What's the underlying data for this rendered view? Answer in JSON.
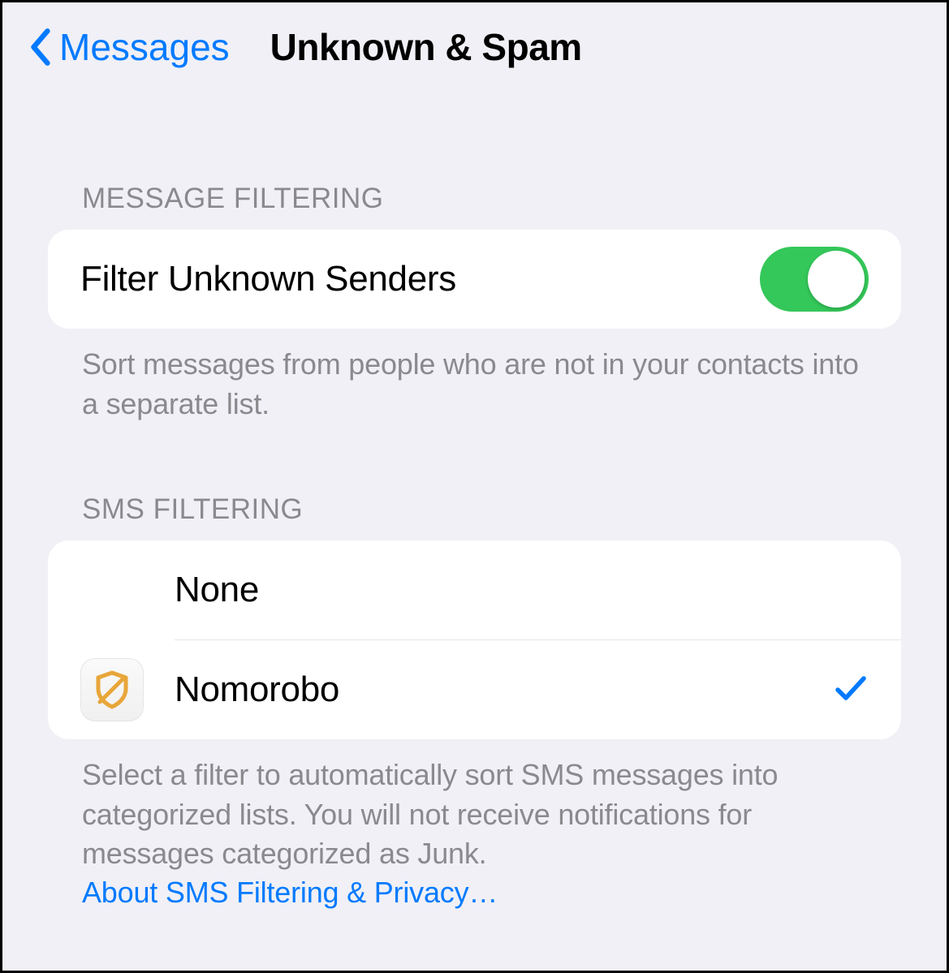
{
  "nav": {
    "back_label": "Messages",
    "title": "Unknown & Spam"
  },
  "sections": {
    "message_filtering": {
      "header": "MESSAGE FILTERING",
      "toggle_label": "Filter Unknown Senders",
      "toggle_on": true,
      "footer": "Sort messages from people who are not in your contacts into a separate list."
    },
    "sms_filtering": {
      "header": "SMS FILTERING",
      "options": [
        {
          "label": "None",
          "selected": false,
          "has_icon": false
        },
        {
          "label": "Nomorobo",
          "selected": true,
          "has_icon": true,
          "icon_name": "nomorobo-shield-icon"
        }
      ],
      "footer": "Select a filter to automatically sort SMS messages into categorized lists. You will not receive notifications for messages categorized as Junk.",
      "link": "About SMS Filtering & Privacy…"
    }
  },
  "colors": {
    "accent": "#007aff",
    "toggle_on": "#34c759",
    "background": "#f0f0f6",
    "secondary_text": "#8a8a8e"
  }
}
